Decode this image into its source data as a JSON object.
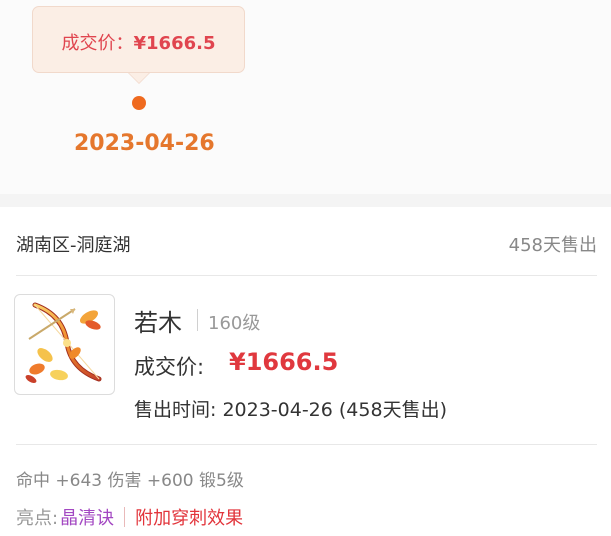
{
  "tooltip": {
    "label": "成交价：",
    "price": "¥1666.5"
  },
  "chart_point": {
    "date": "2023-04-26"
  },
  "server": {
    "name": "湖南区-洞庭湖",
    "sold_days": "458天售出"
  },
  "item": {
    "name": "若木",
    "level": "160级",
    "price_label": "成交价:",
    "price_value": "¥1666.5",
    "sold_time": "售出时间: 2023-04-26 (458天售出)",
    "attributes": "命中 +643 伤害 +600 锻5级",
    "highlights_label": "亮点:",
    "highlight_tags": [
      "晶清诀",
      "附加穿刺效果"
    ]
  },
  "colors": {
    "accent_orange": "#ef6a1f",
    "price_red": "#e0383e",
    "tag_purple": "#a348c2"
  }
}
